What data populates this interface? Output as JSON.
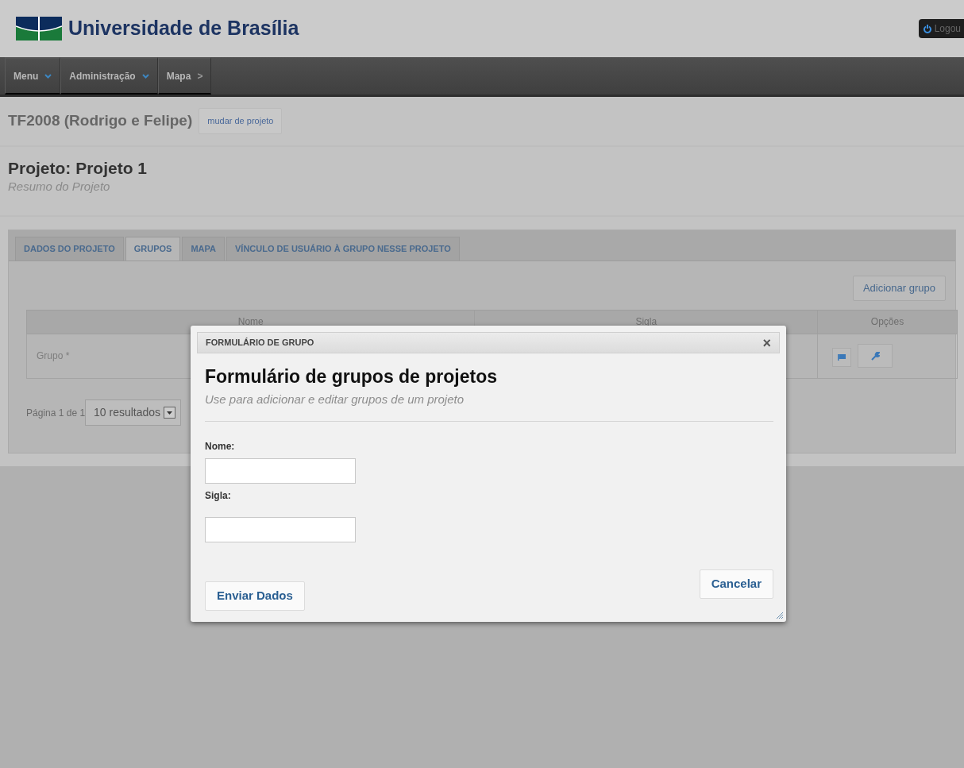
{
  "header": {
    "brand": "Universidade de Brasília",
    "logout": "Logou"
  },
  "nav": [
    {
      "label": "Menu",
      "kind": "dropdown"
    },
    {
      "label": "Administração",
      "kind": "dropdown"
    },
    {
      "label": "Mapa",
      "kind": "link",
      "suffix": ">"
    }
  ],
  "project_bar": {
    "name": "TF2008 (Rodrigo e Felipe)",
    "button": "mudar de projeto"
  },
  "page": {
    "title": "Projeto: Projeto 1",
    "subtitle": "Resumo do Projeto"
  },
  "tabs": [
    {
      "label": "DADOS DO PROJETO",
      "selected": false
    },
    {
      "label": "GRUPOS",
      "selected": true
    },
    {
      "label": "MAPA",
      "selected": false
    },
    {
      "label": "VÍNCULO DE USUÁRIO À GRUPO NESSE PROJETO",
      "selected": false
    }
  ],
  "add_button": "Adicionar grupo",
  "table": {
    "columns": [
      "Nome",
      "Sigla",
      "Opções"
    ],
    "rows": [
      {
        "nome": "Grupo *"
      }
    ]
  },
  "pagination": {
    "text": "Página 1 de 1",
    "page_size": "10 resultados"
  },
  "dialog": {
    "window_title": "FORMULÁRIO DE GRUPO",
    "close": "×",
    "title": "Formulário de grupos de projetos",
    "subtitle": "Use para adicionar e editar grupos de um projeto",
    "fields": [
      {
        "label": "Nome:"
      },
      {
        "label": "Sigla:"
      }
    ],
    "cancel": "Cancelar",
    "submit": "Enviar Dados"
  }
}
